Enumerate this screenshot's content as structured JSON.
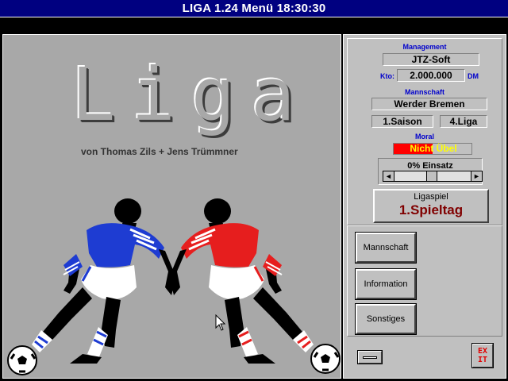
{
  "window": {
    "title": "LIGA 1.24 Menü 18:30:30"
  },
  "splash": {
    "logo": "Liga",
    "credits": "von Thomas Zils + Jens Trümmner"
  },
  "management": {
    "heading": "Management",
    "company": "JTZ-Soft",
    "kto_label": "Kto:",
    "kto_value": "2.000.000",
    "currency": "DM"
  },
  "team": {
    "heading": "Mannschaft",
    "name": "Werder Bremen",
    "season": "1.Saison",
    "league": "4.Liga"
  },
  "moral": {
    "heading": "Moral",
    "value": "Nicht Übel",
    "level": 0.5,
    "fill_color": "#ff0000",
    "text_color": "#ffff00"
  },
  "einsatz": {
    "label": "0% Einsatz",
    "left_arrow": "◄",
    "right_arrow": "►"
  },
  "ligaspiel": {
    "title": "Ligaspiel",
    "value": "1.Spieltag"
  },
  "nav": {
    "team": "Mannschaft",
    "information": "Information",
    "misc": "Sonstiges"
  },
  "exit": {
    "label": "EX IT"
  },
  "icons": {
    "mini": "minimize-bar-icon",
    "exit": "exit-icon"
  },
  "colors": {
    "titlebar": "#000080",
    "label_blue": "#0000cc",
    "spieltag": "#800000",
    "blue_player": "#1e3cd2",
    "red_player": "#e61e1e"
  }
}
